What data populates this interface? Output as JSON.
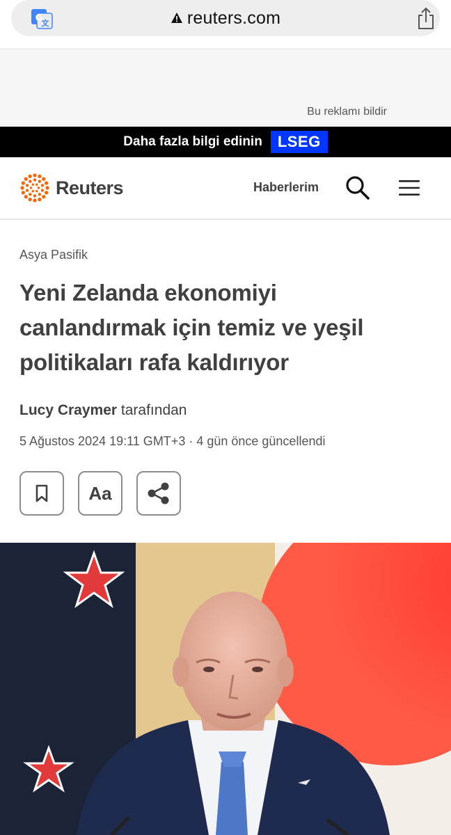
{
  "browser": {
    "url": "reuters.com"
  },
  "ad": {
    "report_label": "Bu reklamı bildir",
    "banner_text": "Daha fazla bilgi edinin",
    "banner_brand": "LSEG"
  },
  "header": {
    "logo_text": "Reuters",
    "my_news": "Haberlerim"
  },
  "article": {
    "section": "Asya Pasifik",
    "headline_lines": [
      "Yeni Zelanda ekonomiyi",
      "canlandırmak için temiz ve yeşil",
      "politikaları rafa kaldırıyor"
    ],
    "author": "Lucy Craymer",
    "byline_suffix": " tarafından",
    "dateline": "5 Ağustos 2024 19:11 GMT+3 · 4 gün önce güncellendi",
    "font_button_label": "Aa"
  },
  "colors": {
    "accent_orange": "#fa6400",
    "banner_blue": "#0037ff",
    "text_dark": "#404040"
  }
}
